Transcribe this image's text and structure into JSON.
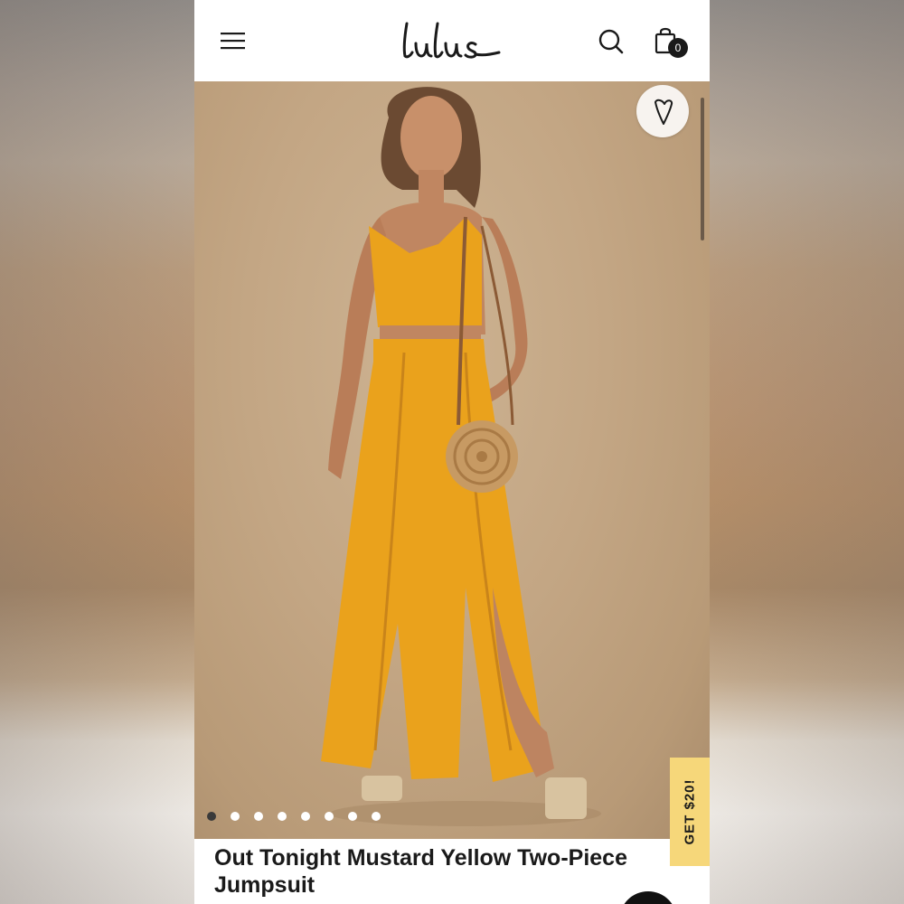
{
  "brand": {
    "logo_text": "Lulus"
  },
  "header": {
    "menu_icon": "hamburger-menu-icon",
    "search_icon": "search-icon",
    "cart_icon": "shopping-bag-icon",
    "cart_count": "0"
  },
  "hero": {
    "favorite_icon": "heart-icon",
    "image_count": 8,
    "active_image_index": 0
  },
  "promo": {
    "label": "GET $20!"
  },
  "product": {
    "title": "Out Tonight Mustard Yellow Two-Piece Jumpsuit"
  },
  "colors": {
    "promo_tab": "#f6d77a",
    "garment": "#eaa21c",
    "backdrop": "#c3a684"
  }
}
